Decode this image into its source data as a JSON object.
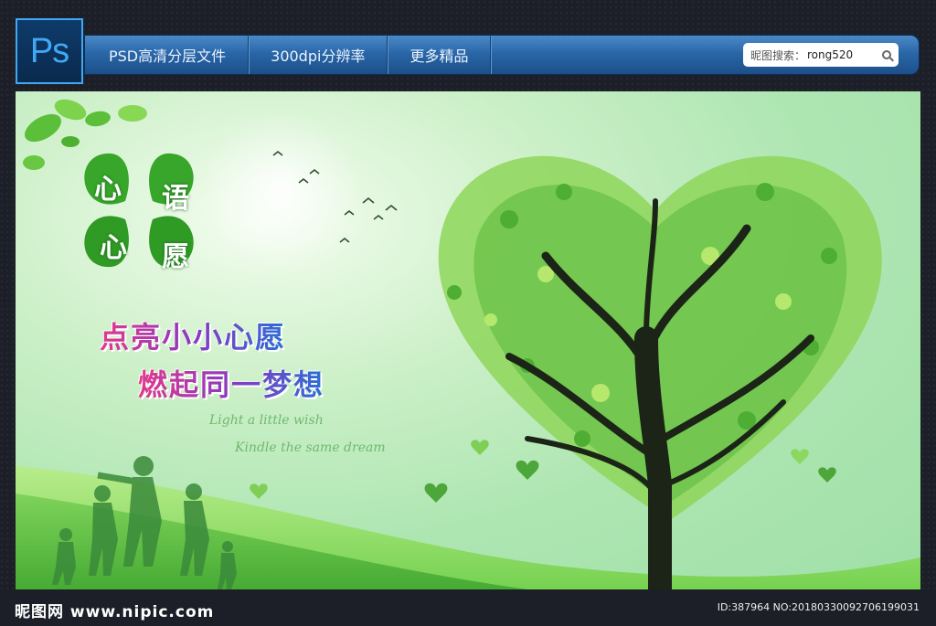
{
  "logo": {
    "text": "Ps"
  },
  "nav": {
    "items": [
      "PSD高清分层文件",
      "300dpi分辨率",
      "更多精品"
    ],
    "search_label": "昵图搜索：",
    "search_value": "rong520"
  },
  "poster": {
    "clover": [
      "心",
      "语",
      "心",
      "愿"
    ],
    "slogan_line1": "点亮小小心愿",
    "slogan_line2": "燃起同一梦想",
    "eng_line1": "Light a little wish",
    "eng_line2": "Kindle the same dream"
  },
  "watermark": {
    "left": "昵图网 www.nipic.com",
    "right": "ID:387964 NO:20180330092706199031"
  },
  "colors": {
    "accent": "#3fa9f5",
    "nav": "#2a67a8",
    "leaf": "#6cc24a"
  }
}
